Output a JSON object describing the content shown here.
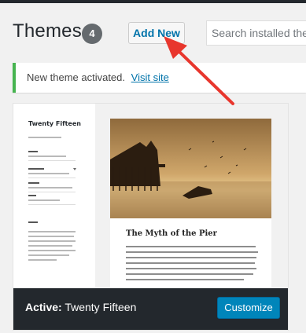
{
  "header": {
    "title": "Themes",
    "count": "4",
    "add_new_label": "Add New",
    "search_placeholder": "Search installed themes..."
  },
  "notice": {
    "message": "New theme activated.",
    "link_text": "Visit site",
    "accent_color": "#46b450"
  },
  "theme": {
    "screenshot": {
      "site_title": "Twenty Fifteen",
      "post_title": "The Myth of the Pier"
    },
    "active_prefix": "Active:",
    "active_name": "Twenty Fifteen",
    "customize_label": "Customize"
  },
  "colors": {
    "link": "#0073aa",
    "primary_button": "#0085ba",
    "dark_bar": "#23282d",
    "annotation_arrow": "#e8362d"
  },
  "icons": [
    "annotation-arrow-icon"
  ]
}
